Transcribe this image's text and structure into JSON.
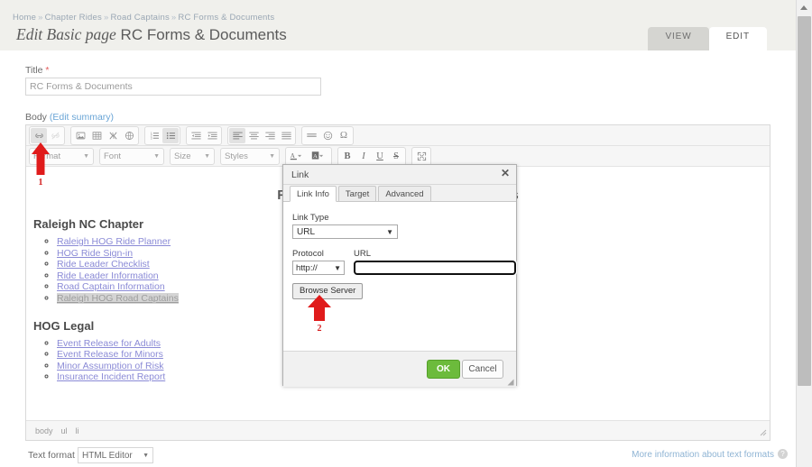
{
  "breadcrumb": {
    "items": [
      "Home",
      "Chapter Rides",
      "Road Captains",
      "RC Forms & Documents"
    ],
    "separator": "»"
  },
  "header": {
    "title_emphasis": "Edit Basic page",
    "title_name": "RC Forms & Documents",
    "tabs": [
      {
        "label": "VIEW",
        "active": false
      },
      {
        "label": "EDIT",
        "active": true
      }
    ]
  },
  "form": {
    "title_label": "Title",
    "title_required_mark": "*",
    "title_value": "RC Forms & Documents",
    "body_label": "Body",
    "edit_summary_label": "(Edit summary)",
    "text_format_label": "Text format",
    "text_format_value": "HTML Editor",
    "more_info_link": "More information about text formats",
    "help_icon_char": "?"
  },
  "toolbar": {
    "row1": [
      {
        "group": "link",
        "buttons": [
          {
            "name": "link-icon",
            "glyph": "⚓",
            "state": "on"
          },
          {
            "name": "unlink-icon",
            "glyph": "⛓",
            "state": "off"
          }
        ]
      },
      {
        "group": "insert",
        "buttons": [
          {
            "name": "image-icon",
            "glyph": "ὛC",
            "state": "normal"
          },
          {
            "name": "table-icon",
            "glyph": "▦",
            "state": "normal"
          },
          {
            "name": "template-icon",
            "glyph": "✆",
            "state": "normal"
          },
          {
            "name": "anchor-icon",
            "glyph": "⎈",
            "state": "normal"
          }
        ]
      },
      {
        "group": "lists",
        "buttons": [
          {
            "name": "numbered-list-icon",
            "glyph": "≣",
            "state": "normal"
          },
          {
            "name": "bulleted-list-icon",
            "glyph": "≣",
            "state": "on"
          }
        ]
      },
      {
        "group": "indent",
        "buttons": [
          {
            "name": "decrease-indent-icon",
            "glyph": "⇤",
            "state": "normal"
          },
          {
            "name": "increase-indent-icon",
            "glyph": "⇥",
            "state": "normal"
          }
        ]
      },
      {
        "group": "align",
        "buttons": [
          {
            "name": "align-left-icon",
            "glyph": "≡",
            "state": "on"
          },
          {
            "name": "align-center-icon",
            "glyph": "≡",
            "state": "normal"
          },
          {
            "name": "align-right-icon",
            "glyph": "≡",
            "state": "normal"
          },
          {
            "name": "align-justify-icon",
            "glyph": "≡",
            "state": "normal"
          }
        ]
      },
      {
        "group": "misc",
        "buttons": [
          {
            "name": "horizontal-rule-icon",
            "glyph": "═",
            "state": "normal"
          },
          {
            "name": "smiley-icon",
            "glyph": "☺",
            "state": "normal"
          },
          {
            "name": "special-character-icon",
            "glyph": "Ω",
            "state": "normal"
          }
        ]
      }
    ],
    "row2_selects": [
      {
        "name": "format-select",
        "label": "Format"
      },
      {
        "name": "font-select",
        "label": "Font"
      },
      {
        "name": "size-select",
        "label": "Size"
      },
      {
        "name": "styles-select",
        "label": "Styles"
      }
    ],
    "row2_buttons": [
      {
        "name": "text-color-icon",
        "glyph": "A"
      },
      {
        "name": "background-color-icon",
        "glyph": "A"
      },
      {
        "name": "bold-icon",
        "glyph": "B"
      },
      {
        "name": "italic-icon",
        "glyph": "I"
      },
      {
        "name": "underline-icon",
        "glyph": "U"
      },
      {
        "name": "strikethrough-icon",
        "glyph": "S"
      },
      {
        "name": "maximize-icon",
        "glyph": "⛶"
      }
    ]
  },
  "document": {
    "heading": "Road Captain Forms and Procedures",
    "sections": [
      {
        "heading": "Raleigh NC Chapter",
        "links": [
          {
            "label": "Raleigh HOG Ride Planner",
            "selected": false
          },
          {
            "label": "HOG Ride Sign-in",
            "selected": false
          },
          {
            "label": "Ride Leader Checklist",
            "selected": false
          },
          {
            "label": "Ride Leader Information",
            "selected": false
          },
          {
            "label": "Road Captain Information",
            "selected": false
          },
          {
            "label": "Raleigh HOG Road Captains",
            "selected": true
          }
        ]
      },
      {
        "heading": "HOG Legal",
        "links": [
          {
            "label": "Event Release for Adults",
            "selected": false
          },
          {
            "label": "Event Release for Minors",
            "selected": false
          },
          {
            "label": "Minor Assumption of Risk",
            "selected": false
          },
          {
            "label": "Insurance Incident Report",
            "selected": false
          }
        ]
      }
    ],
    "element_path": [
      "body",
      "ul",
      "li"
    ]
  },
  "link_dialog": {
    "title": "Link",
    "close_label": "✕",
    "tabs": [
      {
        "label": "Link Info",
        "active": true
      },
      {
        "label": "Target",
        "active": false
      },
      {
        "label": "Advanced",
        "active": false
      }
    ],
    "link_type_label": "Link Type",
    "link_type_value": "URL",
    "protocol_label": "Protocol",
    "protocol_value": "http://",
    "url_label": "URL",
    "url_value": "",
    "browse_server_label": "Browse Server",
    "ok_label": "OK",
    "cancel_label": "Cancel"
  },
  "annotations": [
    {
      "number": "1",
      "target": "link-toolbar-button"
    },
    {
      "number": "2",
      "target": "browse-server-button"
    }
  ],
  "colors": {
    "annotation_red": "#d42020",
    "ok_green": "#6cbb3c",
    "link_blue": "#8a8ad6",
    "breadcrumb_blue": "#9aa7b4",
    "header_band": "#f0f0ec"
  }
}
